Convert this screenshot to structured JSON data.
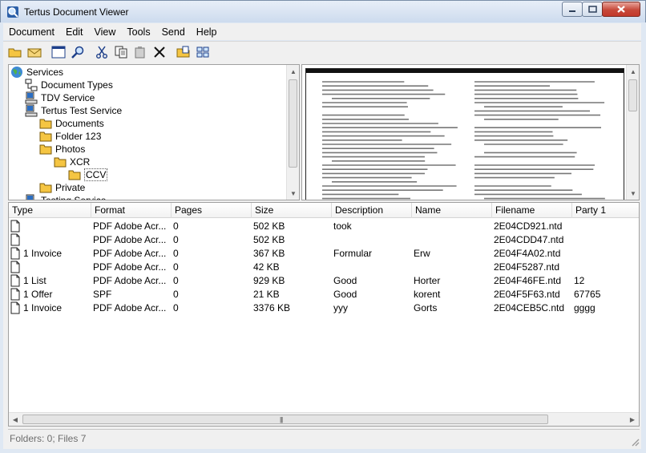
{
  "window": {
    "title": "Tertus Document Viewer"
  },
  "menu": [
    "Document",
    "Edit",
    "View",
    "Tools",
    "Send",
    "Help"
  ],
  "toolbar": [
    {
      "name": "open-folder-icon"
    },
    {
      "name": "envelope-icon"
    },
    {
      "sep": true
    },
    {
      "name": "window-icon"
    },
    {
      "name": "search-icon"
    },
    {
      "sep": true
    },
    {
      "name": "cut-icon"
    },
    {
      "name": "copy-icon"
    },
    {
      "name": "paste-icon"
    },
    {
      "name": "delete-icon"
    },
    {
      "sep": true
    },
    {
      "name": "folder-up-icon"
    },
    {
      "name": "grid-icon"
    }
  ],
  "tree": [
    {
      "label": "Services",
      "icon": "globe",
      "depth": 0
    },
    {
      "label": "Document Types",
      "icon": "doctypes",
      "depth": 1
    },
    {
      "label": "TDV Service",
      "icon": "computer",
      "depth": 1
    },
    {
      "label": "Tertus Test Service",
      "icon": "computer",
      "depth": 1
    },
    {
      "label": "Documents",
      "icon": "folder",
      "depth": 2
    },
    {
      "label": "Folder 123",
      "icon": "folder",
      "depth": 2
    },
    {
      "label": "Photos",
      "icon": "folder",
      "depth": 2
    },
    {
      "label": "XCR",
      "icon": "folder",
      "depth": 3
    },
    {
      "label": "CCV",
      "icon": "folder",
      "depth": 4,
      "selected": true
    },
    {
      "label": "Private",
      "icon": "folder",
      "depth": 2
    },
    {
      "label": "Testing Service",
      "icon": "computer",
      "depth": 1
    }
  ],
  "columns": [
    "Type",
    "Format",
    "Pages",
    "Size",
    "Description",
    "Name",
    "Filename",
    "Party 1"
  ],
  "rows": [
    {
      "type": "",
      "format": "PDF Adobe Acr...",
      "pages": "0",
      "size": "502 KB",
      "description": "took",
      "name": "",
      "filename": "2E04CD921.ntd",
      "party1": ""
    },
    {
      "type": "",
      "format": "PDF Adobe Acr...",
      "pages": "0",
      "size": "502 KB",
      "description": "",
      "name": "",
      "filename": "2E04CDD47.ntd",
      "party1": ""
    },
    {
      "type": "1 Invoice",
      "format": "PDF Adobe Acr...",
      "pages": "0",
      "size": "367 KB",
      "description": "Formular",
      "name": "Erw",
      "filename": "2E04F4A02.ntd",
      "party1": ""
    },
    {
      "type": "",
      "format": "PDF Adobe Acr...",
      "pages": "0",
      "size": "42 KB",
      "description": "",
      "name": "",
      "filename": "2E04F5287.ntd",
      "party1": ""
    },
    {
      "type": "1 List",
      "format": "PDF Adobe Acr...",
      "pages": "0",
      "size": "929 KB",
      "description": "Good",
      "name": "Horter",
      "filename": "2E04F46FE.ntd",
      "party1": "12"
    },
    {
      "type": "1 Offer",
      "format": "SPF",
      "pages": "0",
      "size": "21 KB",
      "description": "Good",
      "name": "korent",
      "filename": "2E04F5F63.ntd",
      "party1": "67765"
    },
    {
      "type": "1 Invoice",
      "format": "PDF Adobe Acr...",
      "pages": "0",
      "size": "3376 KB",
      "description": "yyy",
      "name": "Gorts",
      "filename": "2E04CEB5C.ntd",
      "party1": "gggg"
    }
  ],
  "status": {
    "text": "Folders: 0; Files 7"
  }
}
